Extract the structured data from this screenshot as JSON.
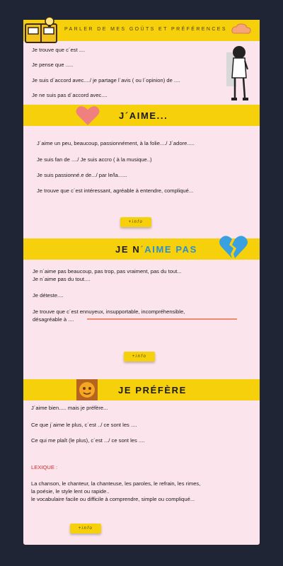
{
  "header": {
    "title": "PARLER DE MES GOÛTS ET PRÉFÉRENCES"
  },
  "intro": [
    "Je trouve que c´est ....",
    "Je pense que .....",
    "Je suis d´accord avec..../ je partage l´avis ( ou l´opinion) de ....",
    "Je ne  suis pas d´accord avec...."
  ],
  "aime": {
    "title": "J´AIME...",
    "lines": [
      "J´aime un peu, beaucoup, passionnément, à la folie..../ J´adore.....",
      "Je suis fan de ..../ Je suis accro ( à la musique..)",
      "Je suis passionné.e de.../ par le/la......",
      "Je trouve que c´est intéressant, agréable à entendre, compliqué..."
    ],
    "info": "+info"
  },
  "naime": {
    "title_a": "JE N",
    "title_b": "´AIME ",
    "title_c": "PAS",
    "lines": [
      "Je n´aime pas beaucoup, pas trop,  pas vraiment, pas du tout...",
      "Je n´aime pas du tout....",
      "Je déteste....",
      "Je trouve que c´est ennuyeux,  insupportable, incompréhensible,",
      "désagréable à ...."
    ],
    "info": "+info"
  },
  "prefere": {
    "title": "JE PRÉFÈRE",
    "lines": [
      "J´aime bien.....  mais je préfère...",
      "Ce que j´aime le plus, c´est ../ ce sont les ....",
      "Ce qui me plaît (le plus), c´est .../ ce sont les ...."
    ],
    "lexique_title": "LEXIQUE :",
    "lexique_lines": [
      "La chanson, le chanteur, la chanteuse, les paroles, le refrain, les rimes,",
      "la poésie, le style lent ou rapide..",
      "le vocabulaire facile ou difficile à comprendre, simple ou compliqué..."
    ],
    "info": "+info"
  }
}
